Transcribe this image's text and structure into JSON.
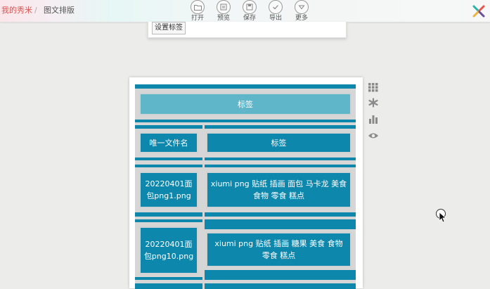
{
  "breadcrumb": {
    "home": "我的秀米",
    "separator": "/",
    "current": "图文排版"
  },
  "toolbar": [
    {
      "label": "打开",
      "icon": "folder-icon"
    },
    {
      "label": "预览",
      "icon": "preview-icon"
    },
    {
      "label": "保存",
      "icon": "save-icon"
    },
    {
      "label": "导出",
      "icon": "export-check-icon"
    },
    {
      "label": "更多",
      "icon": "chevron-down-icon"
    }
  ],
  "panel": {
    "button_label": "设置标签"
  },
  "table": {
    "title": "标签",
    "header": {
      "col1": "唯一文件名",
      "col2": "标签"
    },
    "rows": [
      {
        "file": "20220401面包png1.png",
        "tags": "xiumi png 贴纸 插画 面包 马卡龙 美食 食物 零食 糕点"
      },
      {
        "file": "20220401面包png10.png",
        "tags": "xiumi png 贴纸 插画 糖果 美食 食物 零食 糕点"
      }
    ]
  },
  "colors": {
    "accent": "#0e87ad",
    "title_bg": "#5fb6c9",
    "brand_red": "#d9534f"
  },
  "side_tools": [
    "grid-icon",
    "asterisk-icon",
    "bar-chart-icon",
    "eye-icon"
  ]
}
